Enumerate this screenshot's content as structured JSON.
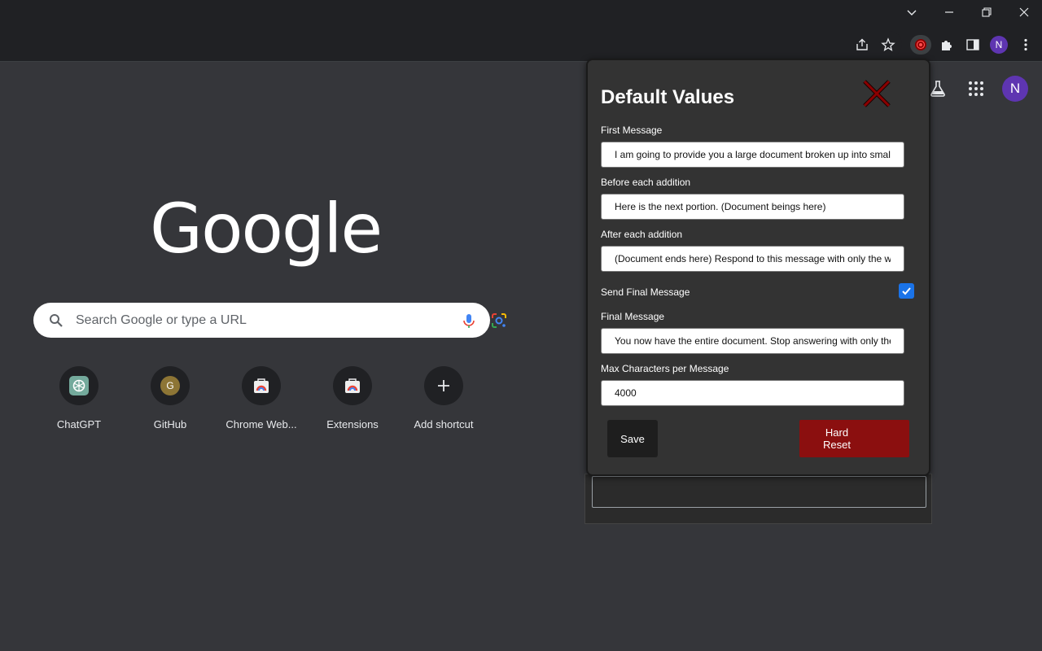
{
  "browser": {
    "avatar_letter": "N"
  },
  "ntp": {
    "logo_text": "Google",
    "search_placeholder": "Search Google or type a URL",
    "avatar_letter": "N",
    "shortcuts": [
      {
        "label": "ChatGPT",
        "icon": "chatgpt-icon"
      },
      {
        "label": "GitHub",
        "icon": "github-icon",
        "letter": "G"
      },
      {
        "label": "Chrome Web...",
        "icon": "chrome-web-store-icon"
      },
      {
        "label": "Extensions",
        "icon": "extensions-store-icon"
      },
      {
        "label": "Add shortcut",
        "icon": "plus-icon"
      }
    ]
  },
  "popup": {
    "title": "Default Values",
    "fields": {
      "first_message": {
        "label": "First Message",
        "value": "I am going to provide you a large document broken up into smal"
      },
      "before_addition": {
        "label": "Before each addition",
        "value": "Here is the next portion. (Document beings here)"
      },
      "after_addition": {
        "label": "After each addition",
        "value": "(Document ends here) Respond to this message with only the w"
      },
      "send_final": {
        "label": "Send Final Message",
        "checked": true
      },
      "final_message": {
        "label": "Final Message",
        "value": "You now have the entire document. Stop answering with only the"
      },
      "max_chars": {
        "label": "Max Characters per Message",
        "value": "4000"
      }
    },
    "save_label": "Save",
    "reset_label_line1": "Hard",
    "reset_label_line2": "Reset"
  },
  "colors": {
    "popup_bg": "#333333",
    "reset_bg": "#8b0f0f",
    "close_icon": "#8b0000",
    "checkbox": "#1a73e8",
    "ntp_bg": "#35363a"
  }
}
